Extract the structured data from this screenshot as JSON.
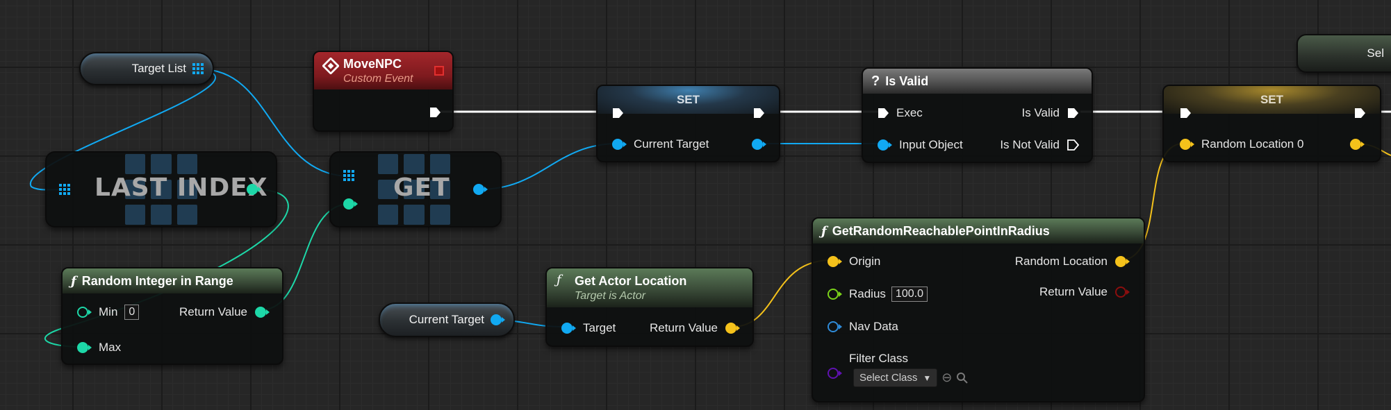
{
  "colors": {
    "exec": "#ffffff",
    "object": "#11a9f2",
    "integer": "#1dd8a8",
    "vector": "#f5c21b",
    "boolean": "#8c0e0e",
    "class": "#5f12b0",
    "navdata": "#2f8bd8"
  },
  "variables": {
    "target_list": "Target List",
    "current_target": "Current Target",
    "partial_label": "Sel"
  },
  "last_index": {
    "title": "LAST INDEX"
  },
  "get": {
    "title": "GET"
  },
  "move_npc": {
    "title": "MoveNPC",
    "subtitle": "Custom Event",
    "icon": "event-diamond-icon"
  },
  "set_current": {
    "title": "SET",
    "input_label": "Current Target"
  },
  "is_valid": {
    "title": "Is Valid",
    "icon": "question-mark-icon",
    "exec_label": "Exec",
    "input_label": "Input Object",
    "out_valid": "Is Valid",
    "out_not_valid": "Is Not Valid"
  },
  "set_random": {
    "title": "SET",
    "input_label": "Random Location 0"
  },
  "random_int": {
    "title": "Random Integer in Range",
    "icon": "function-icon",
    "min_label": "Min",
    "min_value": "0",
    "max_label": "Max",
    "return_label": "Return Value"
  },
  "get_actor_location": {
    "title": "Get Actor Location",
    "subtitle": "Target is Actor",
    "icon": "function-icon",
    "target_label": "Target",
    "return_label": "Return Value"
  },
  "reachable_point": {
    "title": "GetRandomReachablePointInRadius",
    "icon": "function-icon",
    "origin_label": "Origin",
    "radius_label": "Radius",
    "radius_value": "100.0",
    "navdata_label": "Nav Data",
    "filter_label": "Filter Class",
    "select_class": "Select Class",
    "random_location_label": "Random Location",
    "return_label": "Return Value"
  }
}
